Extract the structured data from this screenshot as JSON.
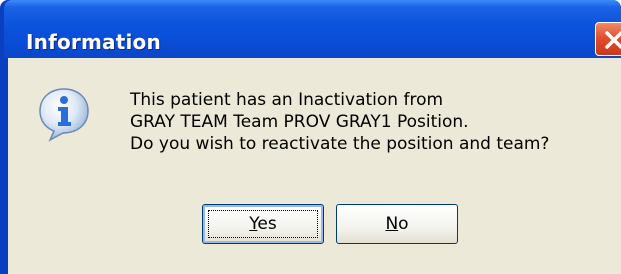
{
  "window": {
    "title": "Information"
  },
  "message": {
    "lines": [
      "This patient has an Inactivation from",
      "GRAY TEAM Team PROV GRAY1 Position.",
      "Do you wish to reactivate the position and team?"
    ]
  },
  "buttons": {
    "yes": {
      "mnemonic": "Y",
      "rest": "es"
    },
    "no": {
      "mnemonic": "N",
      "rest": "o"
    }
  },
  "icons": {
    "dialog": "information-icon",
    "close": "close-icon"
  },
  "colors": {
    "titlebar": "#0a4cd6",
    "client": "#ece9d8",
    "close": "#e2502c",
    "info_icon": "#2a6fd6"
  }
}
